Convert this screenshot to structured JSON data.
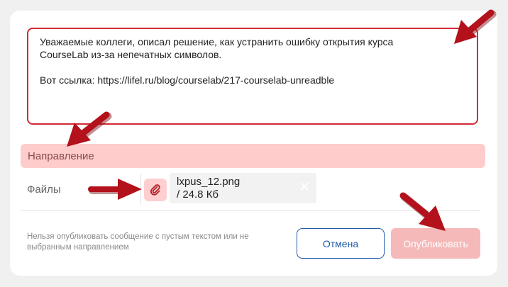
{
  "form": {
    "message_text": "Уважаемые коллеги, описал решение, как устранить ошибку открытия курса\nCourseLab из-за непечатных символов.\n\nВот ссылка: https://lifel.ru/blog/courselab/217-courselab-unreadble",
    "direction_label": "Направление",
    "files_label": "Файлы",
    "attachment": {
      "name": "lxpus_12.png",
      "size": "/ 24.8 Кб"
    },
    "warning_text": "Нельзя опубликовать сообщение с пустым текстом или не выбранным направлением",
    "cancel_label": "Отмена",
    "publish_label": "Опубликовать"
  },
  "colors": {
    "error_border": "#d32b35",
    "error_fill": "#ffcccc",
    "accent_blue": "#1e5aa8",
    "arrow": "#b3111b"
  },
  "icons": {
    "attach": "paperclip-icon",
    "remove": "close-icon",
    "annotation": "arrow-icon"
  }
}
